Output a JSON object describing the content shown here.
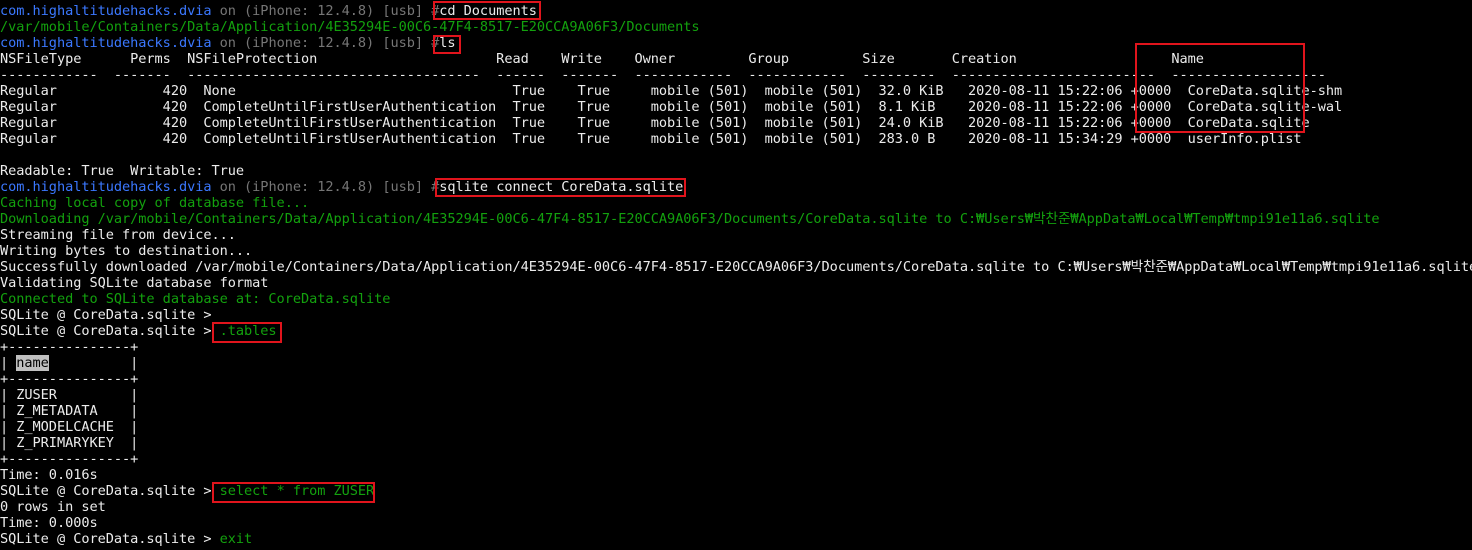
{
  "terminal": {
    "line1": {
      "prefix": "com.highaltitudehacks.dvia",
      "on": " on (iPhone: 12.4.8) [usb] #",
      "cmd": "cd Documents"
    },
    "line2": "/var/mobile/Containers/Data/Application/4E35294E-00C6-47F4-8517-E20CCA9A06F3/Documents",
    "line3": {
      "prefix": "com.highaltitudehacks.dvia",
      "on": " on (iPhone: 12.4.8) [usb] #",
      "cmd": "ls"
    },
    "ls_header": "NSFileType      Perms  NSFileProtection                      Read    Write    Owner         Group         Size       Creation                   Name",
    "ls_sep": "------------  -------  ------------------------------------  ------  -------  ------------  ------------  ---------  -------------------------  -------------------",
    "ls_rows": [
      "Regular             420  None                                  True    True     mobile (501)  mobile (501)  32.0 KiB   2020-08-11 15:22:06 +0000  CoreData.sqlite-shm",
      "Regular             420  CompleteUntilFirstUserAuthentication  True    True     mobile (501)  mobile (501)  8.1 KiB    2020-08-11 15:22:06 +0000  CoreData.sqlite-wal",
      "Regular             420  CompleteUntilFirstUserAuthentication  True    True     mobile (501)  mobile (501)  24.0 KiB   2020-08-11 15:22:06 +0000  CoreData.sqlite",
      "Regular             420  CompleteUntilFirstUserAuthentication  True    True     mobile (501)  mobile (501)  283.0 B    2020-08-11 15:34:29 +0000  userInfo.plist"
    ],
    "readable": "Readable: True  Writable: True",
    "line_connect": {
      "prefix": "com.highaltitudehacks.dvia",
      "on": " on (iPhone: 12.4.8) [usb] #",
      "cmd": "sqlite connect CoreData.sqlite"
    },
    "caching": "Caching local copy of database file...",
    "downloading": "Downloading /var/mobile/Containers/Data/Application/4E35294E-00C6-47F4-8517-E20CCA9A06F3/Documents/CoreData.sqlite to C:₩Users₩박찬준₩AppData₩Local₩Temp₩tmpi91e11a6.sqlite",
    "streaming": "Streaming file from device...",
    "writing": "Writing bytes to destination...",
    "success": "Successfully downloaded /var/mobile/Containers/Data/Application/4E35294E-00C6-47F4-8517-E20CCA9A06F3/Documents/CoreData.sqlite to C:₩Users₩박찬준₩AppData₩Local₩Temp₩tmpi91e11a6.sqlite",
    "validating": "Validating SQLite database format",
    "connected": "Connected to SQLite database at: CoreData.sqlite",
    "sql_prompt": "SQLite @ CoreData.sqlite > ",
    "cmd_tables": ".tables",
    "table_border": "+---------------+",
    "table_header_pre": "| ",
    "table_header_name": "name",
    "table_header_post": "          |",
    "table_rows": [
      "| ZUSER         |",
      "| Z_METADATA    |",
      "| Z_MODELCACHE  |",
      "| Z_PRIMARYKEY  |"
    ],
    "time1": "Time: 0.016s",
    "cmd_select": "select * from ZUSER",
    "rows_in_set": "0 rows in set",
    "time2": "Time: 0.000s",
    "cmd_exit": "exit"
  }
}
